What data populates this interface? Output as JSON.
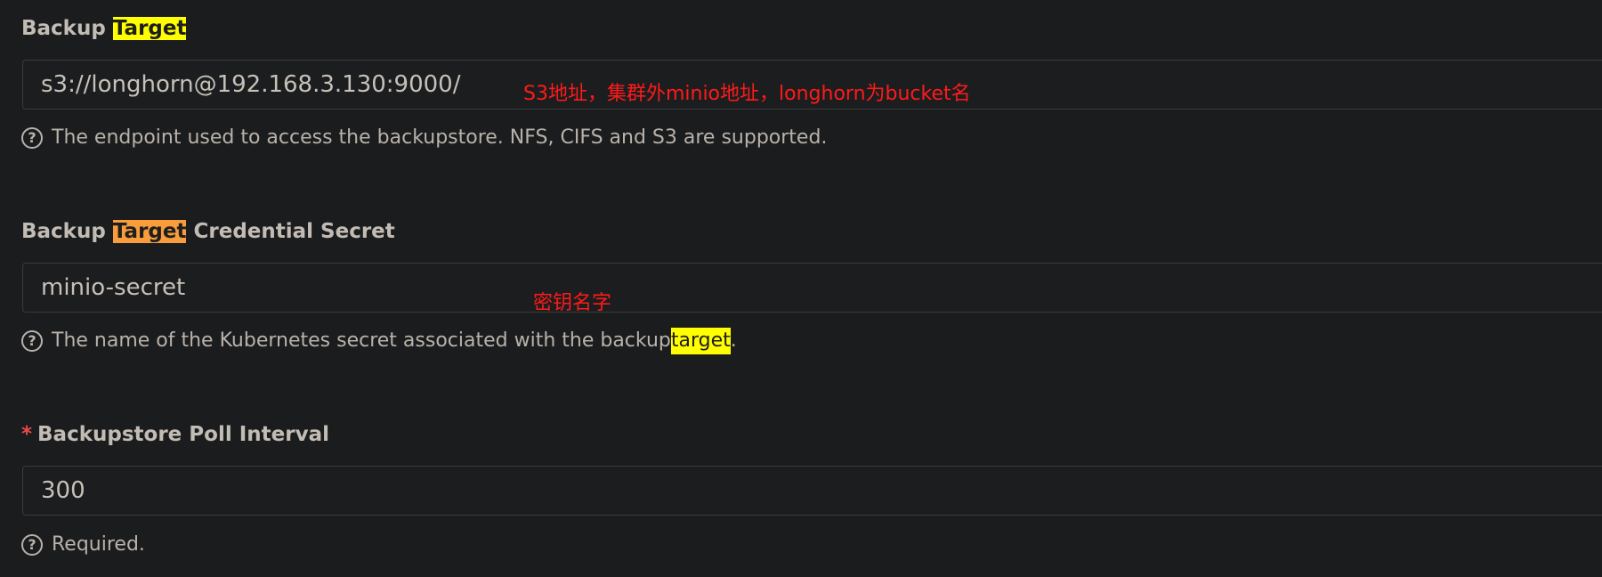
{
  "backup_target": {
    "label_prefix": "Backup ",
    "label_highlight": "Target",
    "value": "s3://longhorn@192.168.3.130:9000/",
    "help_text": "The endpoint used to access the backupstore. NFS, CIFS and S3 are supported.",
    "annotation": "S3地址，集群外minio地址，longhorn为bucket名"
  },
  "credential_secret": {
    "label_prefix": "Backup ",
    "label_highlight": "Target",
    "label_suffix": " Credential Secret",
    "value": "minio-secret",
    "help_text_prefix": "The name of the Kubernetes secret associated with the backup ",
    "help_text_highlight": "target",
    "help_text_suffix": ".",
    "annotation": "密钥名字"
  },
  "poll_interval": {
    "required_mark": "*",
    "label": "Backupstore Poll Interval",
    "value": "300",
    "help_text": "Required."
  },
  "icons": {
    "help": "question-circle-icon",
    "help_glyph": "?"
  },
  "colors": {
    "background": "#1b1c1e",
    "highlight_yellow": "#ffff00",
    "highlight_orange": "#f89c3c",
    "annotation_red": "#ff1a1a",
    "required_red": "#e84a46"
  }
}
